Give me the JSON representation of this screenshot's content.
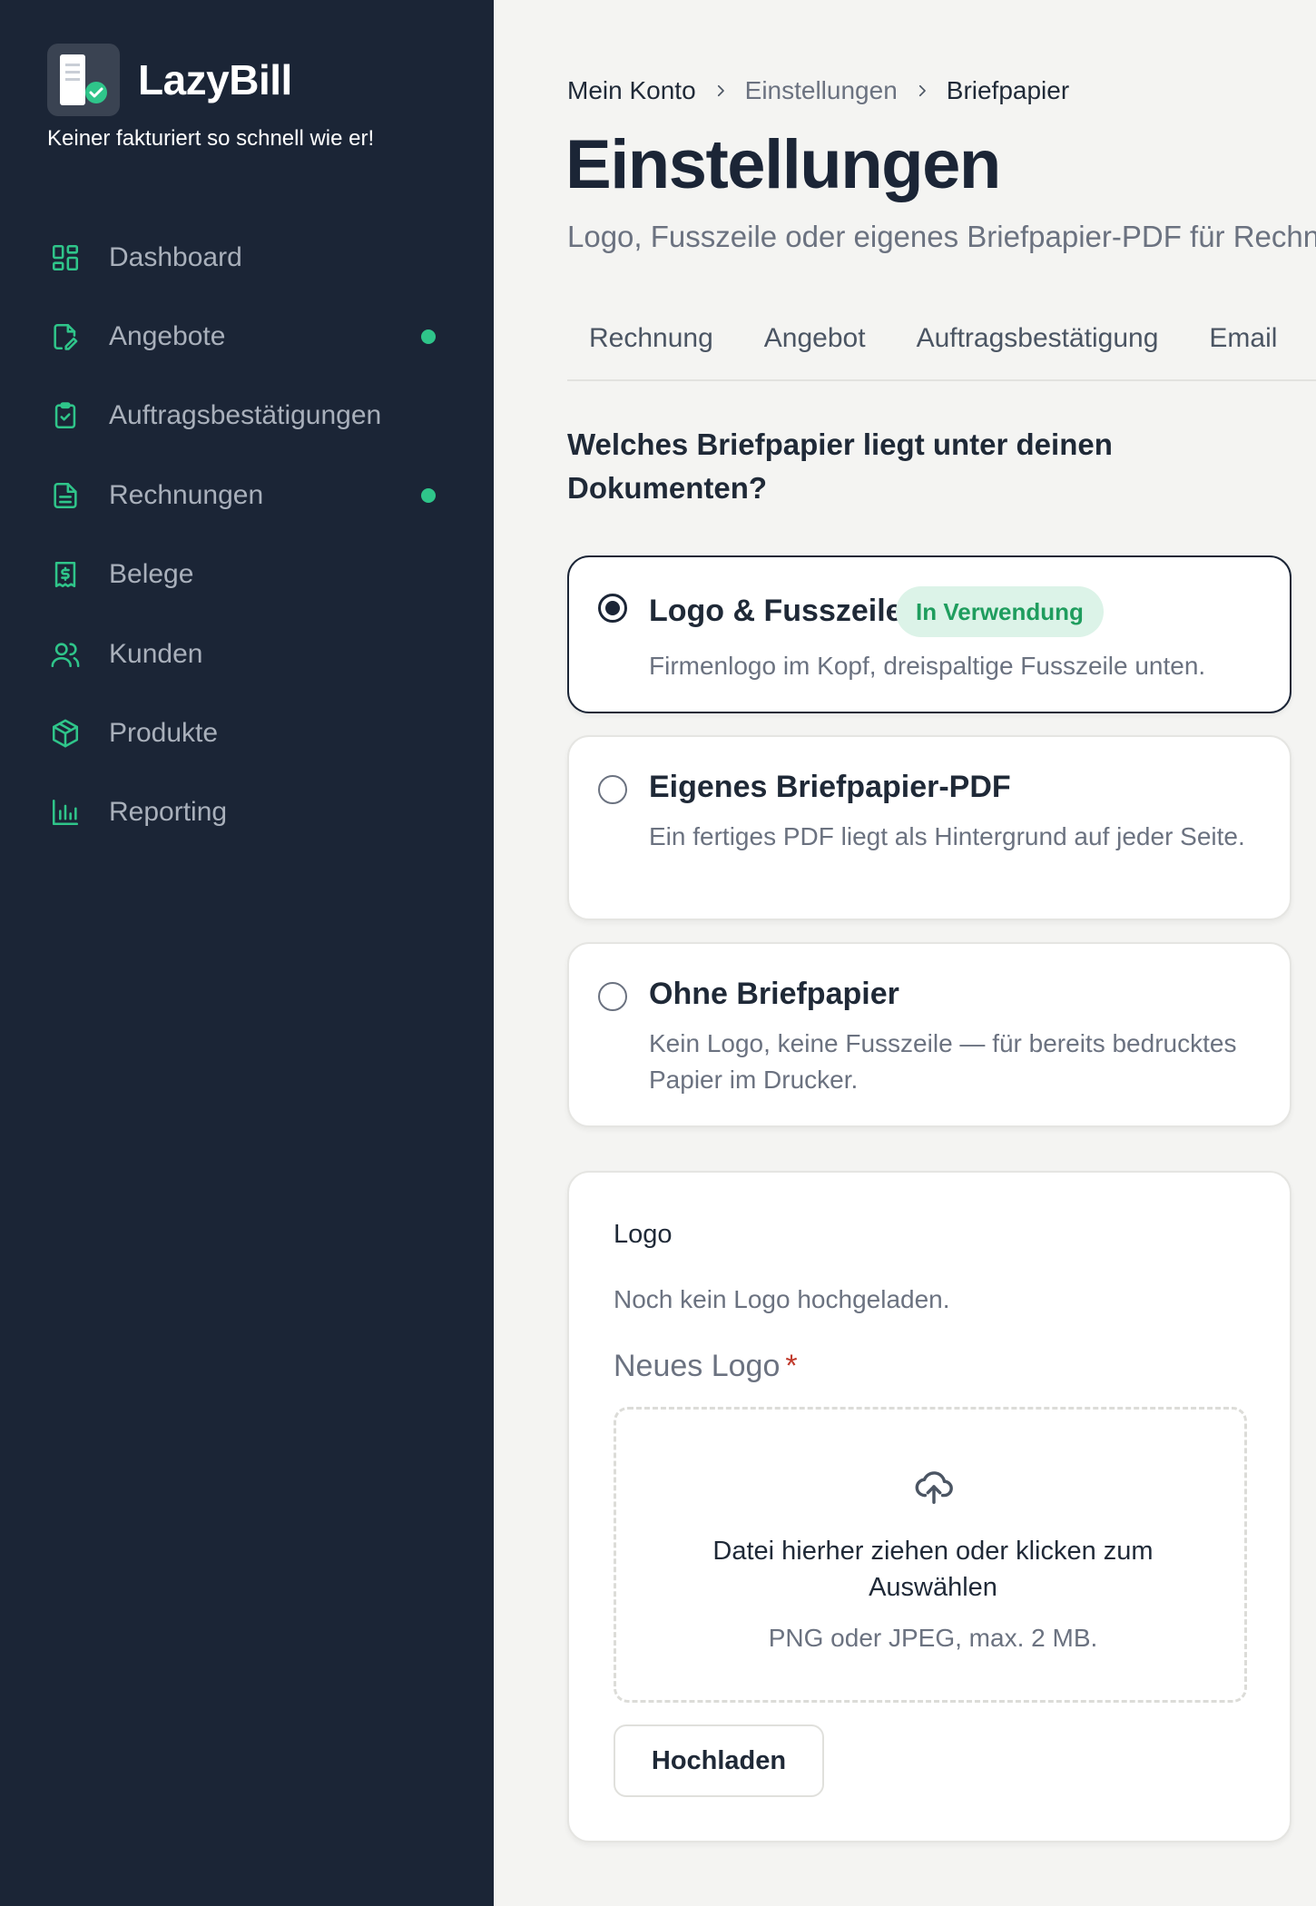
{
  "brand": {
    "name": "LazyBill",
    "tagline": "Keiner fakturiert so schnell wie er!"
  },
  "sidebar": {
    "items": [
      {
        "label": "Dashboard",
        "icon": "dashboard-icon",
        "dot": false
      },
      {
        "label": "Angebote",
        "icon": "document-edit-icon",
        "dot": true
      },
      {
        "label": "Auftragsbestätigungen",
        "icon": "clipboard-check-icon",
        "dot": false
      },
      {
        "label": "Rechnungen",
        "icon": "invoice-icon",
        "dot": true
      },
      {
        "label": "Belege",
        "icon": "receipt-icon",
        "dot": false
      },
      {
        "label": "Kunden",
        "icon": "users-icon",
        "dot": false
      },
      {
        "label": "Produkte",
        "icon": "package-icon",
        "dot": false
      },
      {
        "label": "Reporting",
        "icon": "bar-chart-icon",
        "dot": false
      }
    ]
  },
  "breadcrumb": [
    "Mein Konto",
    "Einstellungen",
    "Briefpapier"
  ],
  "page": {
    "title": "Einstellungen",
    "subtitle": "Logo, Fusszeile oder eigenes Briefpapier-PDF für Rechn"
  },
  "tabs": [
    "Rechnung",
    "Angebot",
    "Auftragsbestätigung",
    "Email"
  ],
  "question": "Welches Briefpapier liegt unter deinen Dokumenten?",
  "options": [
    {
      "title": "Logo & Fusszeile",
      "description": "Firmenlogo im Kopf, dreispaltige Fusszeile unten.",
      "badge": "In Verwendung",
      "selected": true
    },
    {
      "title": "Eigenes Briefpapier-PDF",
      "description": "Ein fertiges PDF liegt als Hintergrund auf jeder Seite.",
      "selected": false
    },
    {
      "title": "Ohne Briefpapier",
      "description": "Kein Logo, keine Fusszeile — für bereits bedrucktes Papier im Drucker.",
      "selected": false
    }
  ],
  "logo_section": {
    "title": "Logo",
    "status": "Noch kein Logo hochgeladen.",
    "field_label": "Neues Logo",
    "required_mark": "*",
    "dropzone_text": "Datei hierher ziehen oder klicken zum Auswählen",
    "dropzone_hint": "PNG oder JPEG, max. 2 MB.",
    "upload_button": "Hochladen"
  },
  "colors": {
    "sidebar_bg": "#1b2536",
    "accent": "#2fc58a",
    "page_bg": "#f4f4f2",
    "badge_bg": "#dcf3e8",
    "badge_text": "#1f9d5e"
  }
}
